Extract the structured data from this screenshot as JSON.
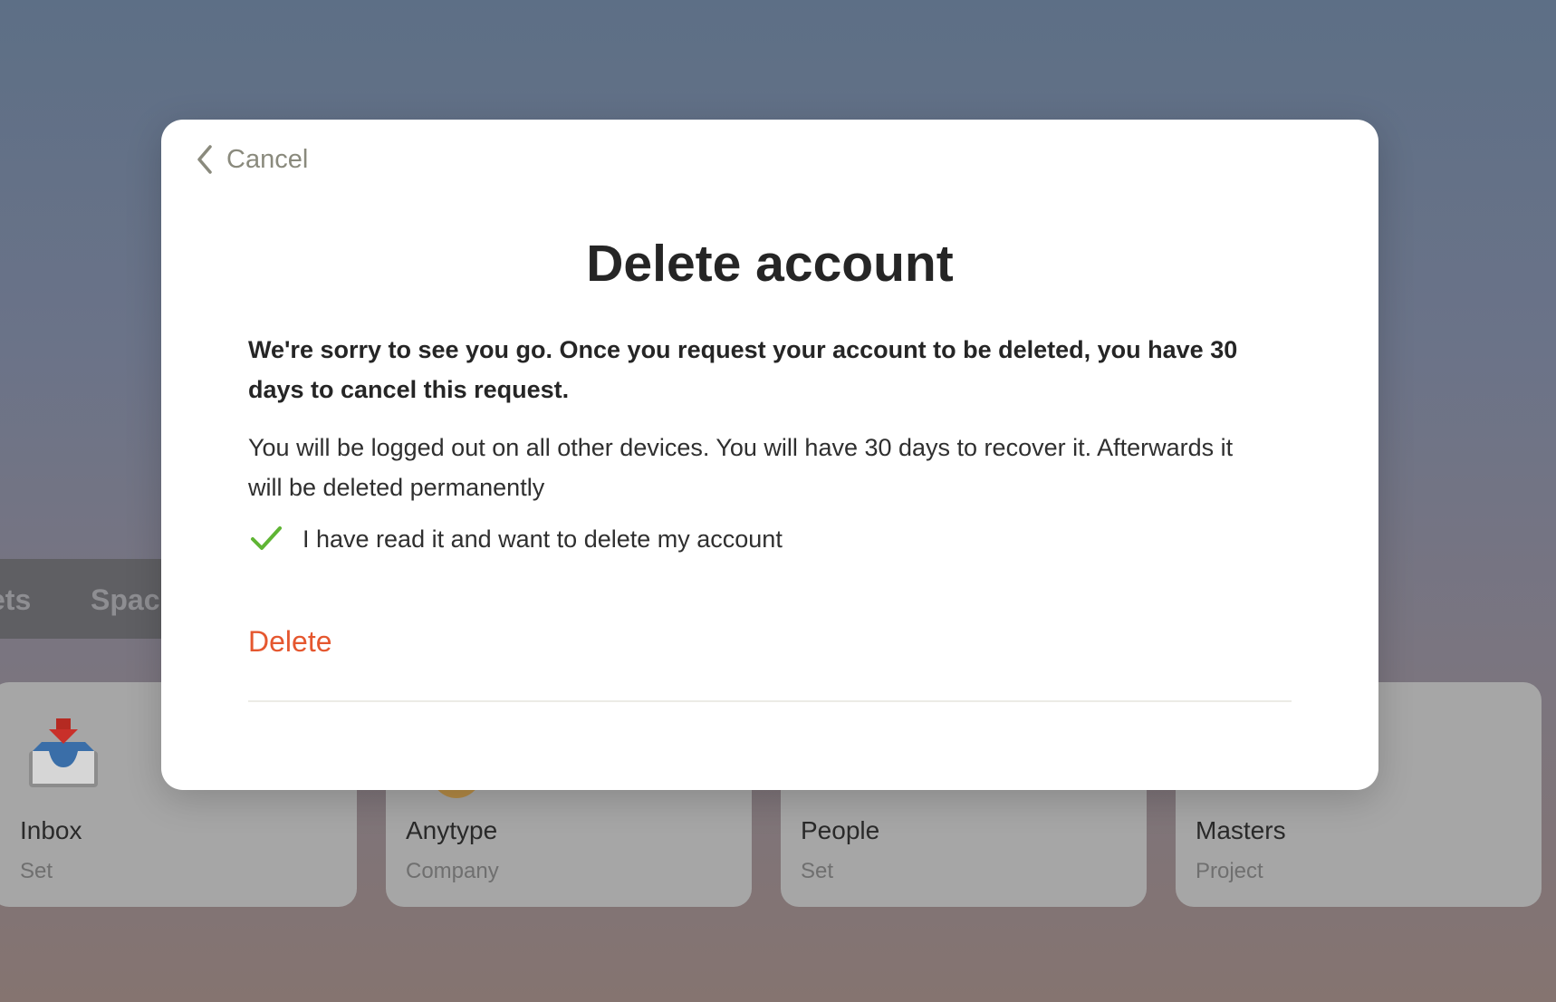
{
  "background": {
    "tabs": [
      {
        "label": "ets"
      },
      {
        "label": "Spac"
      }
    ],
    "cards": [
      {
        "title": "Inbox",
        "subtitle": "Set",
        "icon": "inbox-tray-icon"
      },
      {
        "title": "Anytype",
        "subtitle": "Company",
        "icon": "avatar"
      },
      {
        "title": "People",
        "subtitle": "Set"
      },
      {
        "title": "Masters",
        "subtitle": "Project"
      }
    ]
  },
  "modal": {
    "back_label": "Cancel",
    "title": "Delete account",
    "lead": "We're sorry to see you go. Once you request your account to be deleted, you have 30 days to cancel this request.",
    "description": "You will be logged out on all other devices. You will have 30 days to recover it. Afterwards it will be deleted permanently",
    "confirm_label": "I have read it and want to delete my account",
    "confirm_checked": true,
    "delete_label": "Delete"
  },
  "colors": {
    "danger": "#e5572f",
    "check": "#5fb534",
    "muted": "#8a8a7d"
  }
}
